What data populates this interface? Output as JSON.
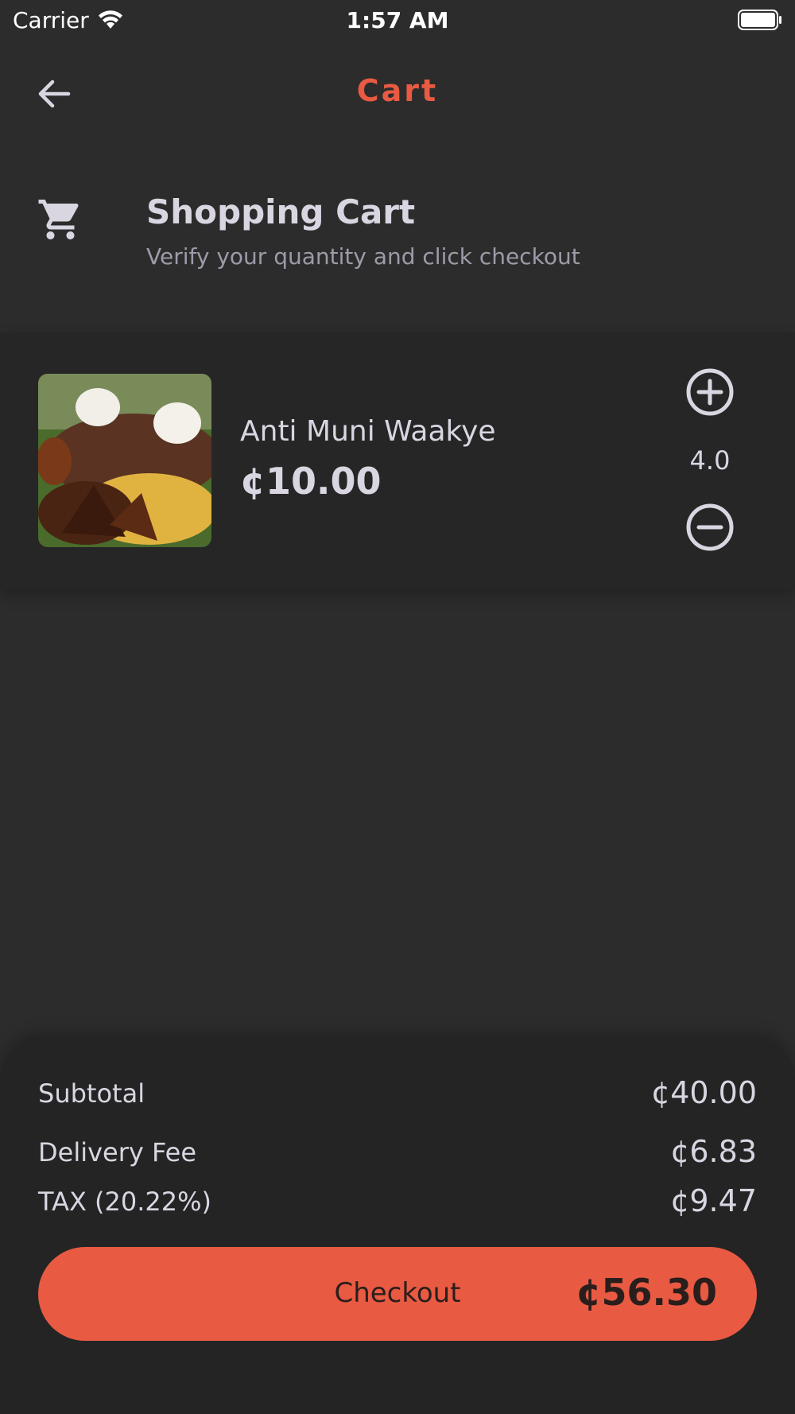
{
  "status_bar": {
    "carrier": "Carrier",
    "time": "1:57 AM"
  },
  "app_bar": {
    "title": "Cart",
    "back_icon": "arrow-left-icon"
  },
  "header": {
    "icon": "shopping-cart-icon",
    "title": "Shopping Cart",
    "subtitle": "Verify your quantity and click checkout"
  },
  "cart": {
    "items": [
      {
        "name": "Anti Muni Waakye",
        "price": "¢10.00",
        "quantity": "4.0"
      }
    ]
  },
  "summary": {
    "subtotal_label": "Subtotal",
    "subtotal_value": "¢40.00",
    "delivery_label": "Delivery Fee",
    "delivery_value": "¢6.83",
    "tax_label": "TAX (20.22%)",
    "tax_value": "¢9.47",
    "checkout_label": "Checkout",
    "checkout_total": "¢56.30"
  },
  "colors": {
    "accent": "#e85a42",
    "background": "#2c2c2c",
    "card": "#262626",
    "text": "#d9d6e2"
  }
}
